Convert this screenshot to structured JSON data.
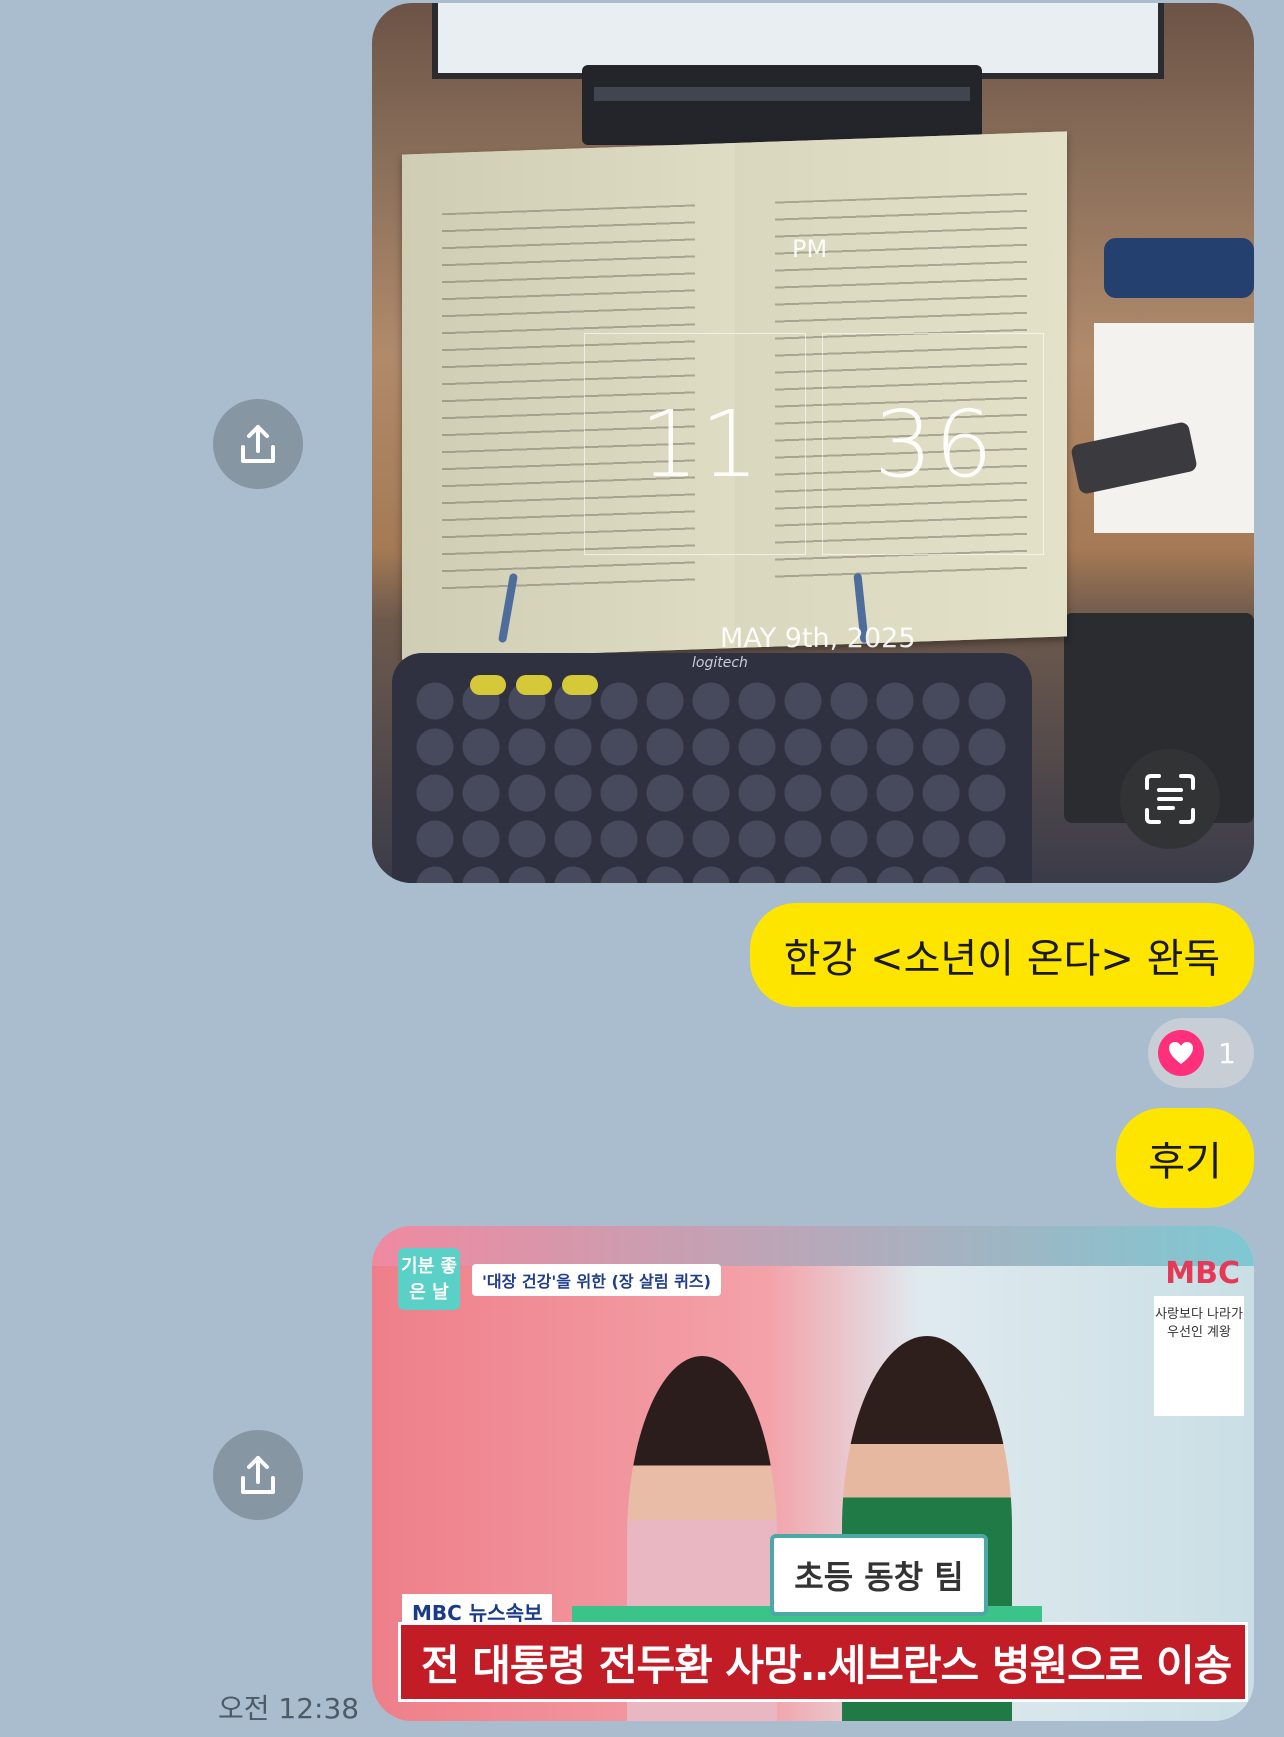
{
  "chat": {
    "messages": [
      {
        "type": "image",
        "description_tags": [
          "open-book",
          "bookstand",
          "keyboard",
          "clock-overlay"
        ],
        "overlay": {
          "period": "PM",
          "hour": "11",
          "minute": "36",
          "date": "MAY 9th, 2025",
          "keyboard_brand": "logitech"
        }
      },
      {
        "type": "text",
        "text": "한강 <소년이 온다> 완독"
      },
      {
        "type": "reaction",
        "icon": "heart-icon",
        "count": "1"
      },
      {
        "type": "text",
        "text": "후기"
      },
      {
        "type": "image",
        "tv": {
          "program_logo": "기분 좋은 날",
          "quiz_tag": "'대장 건강'을 위한 (장 살림 퀴즈)",
          "channel_logo": "MBC",
          "side_poster": "사랑보다 나라가 우선인 계왕",
          "team_board": "초등 동창 팀",
          "news_label": "MBC 뉴스속보",
          "news_headline": "전 대통령 전두환 사망‥세브란스 병원으로 이송"
        }
      }
    ],
    "timestamp": "오전 12:38"
  },
  "colors": {
    "background": "#a9bdce",
    "bubble": "#fee500",
    "share_button": "#8796a3",
    "heart": "#ff2f7b",
    "news_bar": "#c21c27"
  }
}
